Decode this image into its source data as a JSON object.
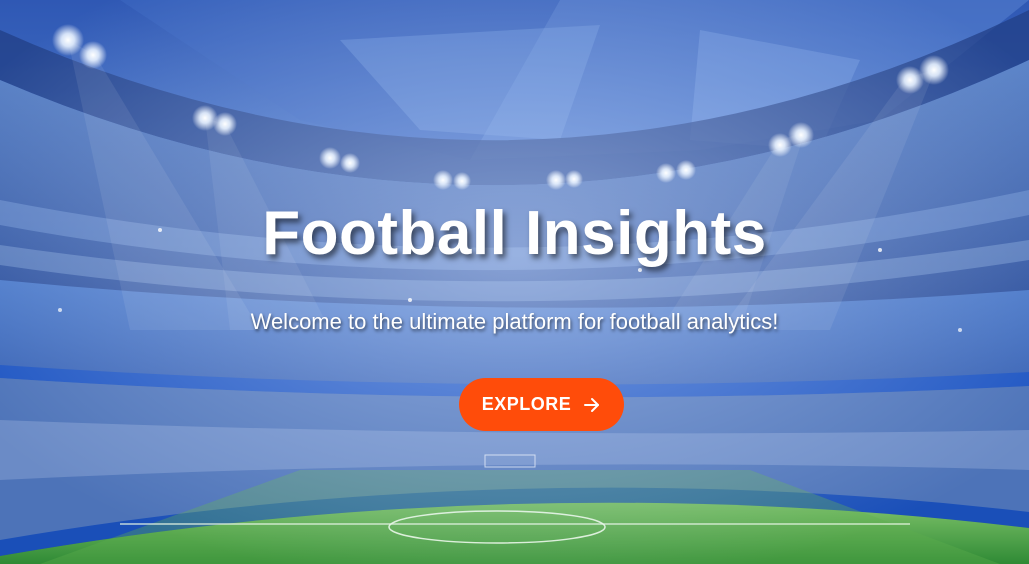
{
  "hero": {
    "title": "Football Insights",
    "subtitle": "Welcome to the ultimate platform for football analytics!",
    "cta_label": "EXPLORE",
    "cta_icon": "arrow-right-icon"
  },
  "colors": {
    "accent": "#ff4c0a",
    "sky_dark": "#0b2a7a",
    "sky_light": "#6f9be0",
    "pitch": "#3f9a3a"
  }
}
